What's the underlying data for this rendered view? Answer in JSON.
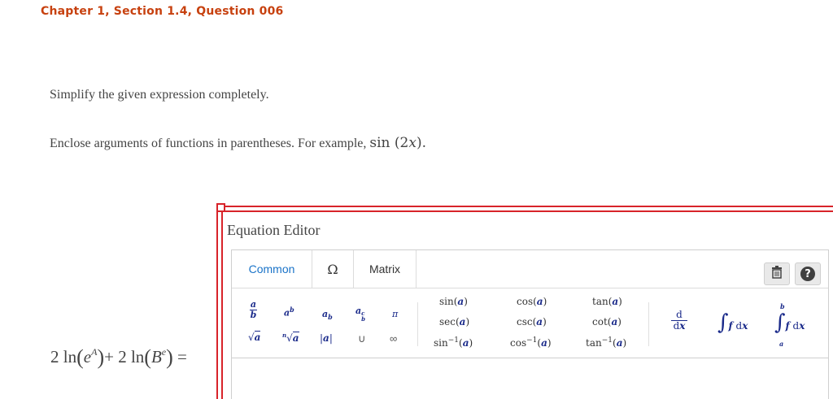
{
  "header": {
    "chapter_title": "Chapter 1, Section 1.4, Question 006"
  },
  "question": {
    "instruction": "Simplify the given expression completely.",
    "hint_prefix": "Enclose arguments of functions in parentheses. For example,",
    "hint_example": "sin (2x)."
  },
  "expression": {
    "text": "2 ln(e^A) + 2 ln(B^e) ="
  },
  "editor": {
    "title": "Equation Editor",
    "tabs": [
      "Common",
      "Ω",
      "Matrix"
    ],
    "active_tab": "Common",
    "functions": {
      "row1": [
        "sin(a)",
        "cos(a)",
        "tan(a)"
      ],
      "row2": [
        "sec(a)",
        "csc(a)",
        "cot(a)"
      ],
      "row3": [
        "sin⁻¹(a)",
        "cos⁻¹(a)",
        "tan⁻¹(a)"
      ]
    },
    "symbols": [
      "a/b",
      "a^b",
      "a_b",
      "a^c_b",
      "π",
      "√a",
      "ⁿ√a",
      "|a|",
      "∪",
      "∞"
    ],
    "calculus": [
      "d/dx",
      "∫ f dx",
      "∫ₐᵇ f dx"
    ],
    "icons": [
      "trash-icon",
      "help-icon"
    ],
    "accent_color": "#1a73c8",
    "frame_color": "#d8232a"
  }
}
